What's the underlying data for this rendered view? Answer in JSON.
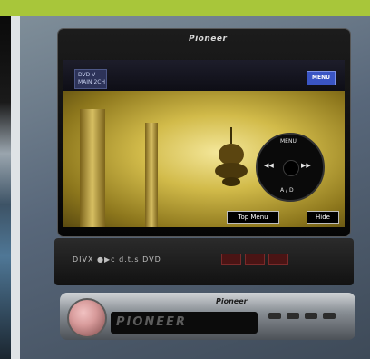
{
  "head_unit": {
    "brand_top": "Pioneer",
    "brand_faceplate": "Pioneer",
    "brand_display": "PIONEER"
  },
  "screen": {
    "status_line1": "DVD V",
    "status_line2": "MAIN 2CH",
    "menu_button": "MENU",
    "dpad_top_label": "MENU",
    "dpad_bottom_label": "A / D",
    "top_menu_button": "Top Menu",
    "hide_button": "Hide"
  },
  "lower_panel": {
    "text": "DIVX  ●▶c  d.t.s  DVD"
  }
}
